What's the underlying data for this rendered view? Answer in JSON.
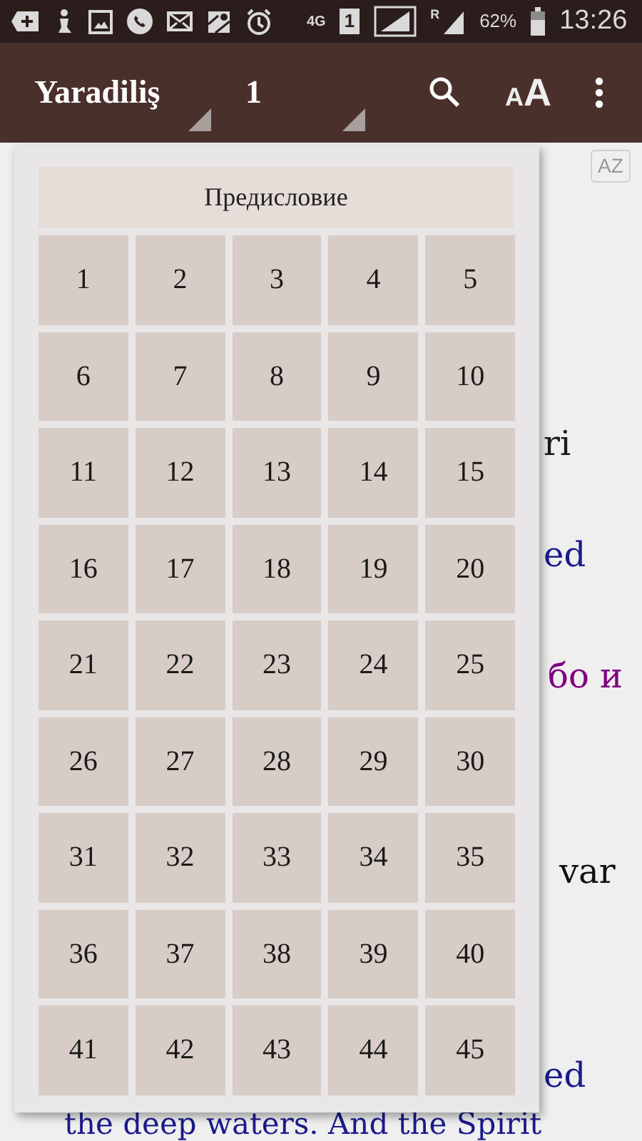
{
  "status_bar": {
    "network": "4G",
    "sim": "1",
    "roaming": "R",
    "battery": "62%",
    "time": "13:26"
  },
  "toolbar": {
    "book": "Yaradiliş",
    "chapter": "1",
    "font_button": {
      "small": "A",
      "large": "A"
    }
  },
  "az_badge": "AZ",
  "verse_fragments": [
    {
      "text": "ri",
      "color": "#1a1a1a"
    },
    {
      "text": "ed",
      "color": "#1a1a8c"
    },
    {
      "text": "бо и",
      "color": "#800080"
    },
    {
      "text": "var",
      "color": "#111111"
    },
    {
      "text": "ed",
      "color": "#1a1a8c"
    },
    {
      "text": "the deep waters. And the Spirit",
      "color": "#1a1a8c"
    }
  ],
  "chapter_picker": {
    "preface": "Предисловие",
    "chapters": [
      "1",
      "2",
      "3",
      "4",
      "5",
      "6",
      "7",
      "8",
      "9",
      "10",
      "11",
      "12",
      "13",
      "14",
      "15",
      "16",
      "17",
      "18",
      "19",
      "20",
      "21",
      "22",
      "23",
      "24",
      "25",
      "26",
      "27",
      "28",
      "29",
      "30",
      "31",
      "32",
      "33",
      "34",
      "35",
      "36",
      "37",
      "38",
      "39",
      "40",
      "41",
      "42",
      "43",
      "44",
      "45"
    ]
  }
}
